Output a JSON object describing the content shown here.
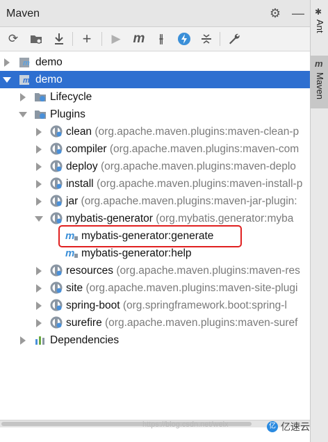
{
  "panel": {
    "title": "Maven"
  },
  "tree": {
    "root_collapsed": "demo",
    "root_expanded": "demo",
    "lifecycle": "Lifecycle",
    "plugins": "Plugins",
    "plugin_items": [
      {
        "name": "clean",
        "coord": "(org.apache.maven.plugins:maven-clean-p"
      },
      {
        "name": "compiler",
        "coord": "(org.apache.maven.plugins:maven-com"
      },
      {
        "name": "deploy",
        "coord": "(org.apache.maven.plugins:maven-deplo"
      },
      {
        "name": "install",
        "coord": "(org.apache.maven.plugins:maven-install-p"
      },
      {
        "name": "jar",
        "coord": "(org.apache.maven.plugins:maven-jar-plugin:"
      },
      {
        "name": "mybatis-generator",
        "coord": "(org.mybatis.generator:myba"
      },
      {
        "name": "resources",
        "coord": "(org.apache.maven.plugins:maven-res"
      },
      {
        "name": "site",
        "coord": "(org.apache.maven.plugins:maven-site-plugi"
      },
      {
        "name": "spring-boot",
        "coord": "(org.springframework.boot:spring-l"
      },
      {
        "name": "surefire",
        "coord": "(org.apache.maven.plugins:maven-suref"
      }
    ],
    "goals": [
      "mybatis-generator:generate",
      "mybatis-generator:help"
    ],
    "dependencies": "Dependencies"
  },
  "right_tabs": [
    "Ant",
    "Maven"
  ],
  "watermark": "https://blog.csdn.net/weix",
  "brand": {
    "logo": "亿",
    "name": "亿速云"
  },
  "colors": {
    "selection": "#2e6fd0",
    "highlight_box": "#e02020"
  }
}
